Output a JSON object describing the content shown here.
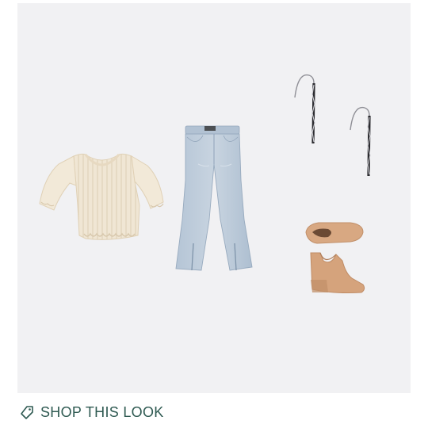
{
  "look": {
    "items": [
      {
        "name": "sweater"
      },
      {
        "name": "jeans"
      },
      {
        "name": "earrings"
      },
      {
        "name": "booties"
      }
    ],
    "background_color": "#f1f1f3"
  },
  "cta": {
    "label": "SHOP THIS LOOK",
    "icon": "tag-icon",
    "color": "#2f5a52"
  }
}
